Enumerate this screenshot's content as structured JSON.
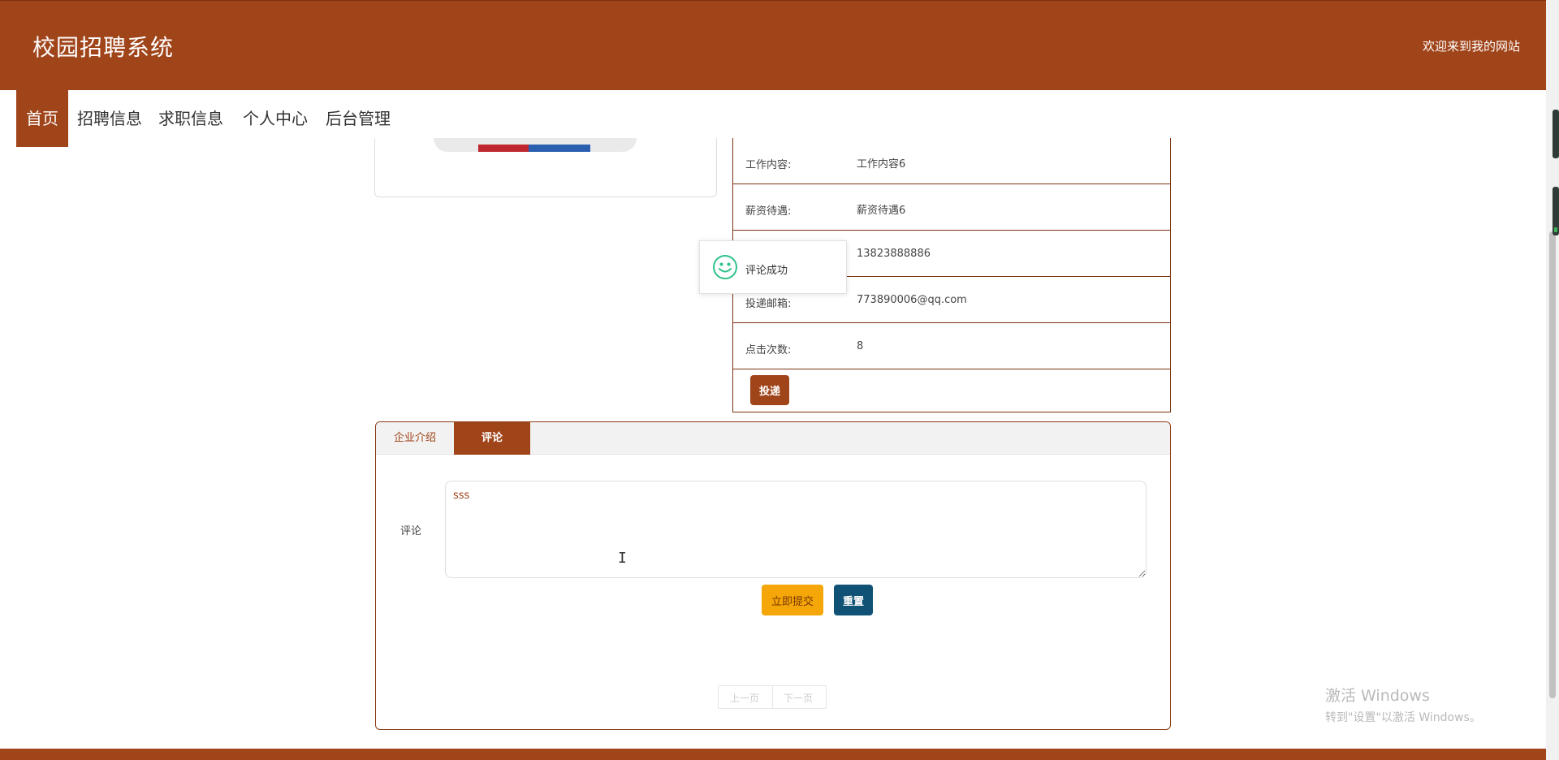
{
  "header": {
    "site_title": "校园招聘系统",
    "welcome": "欢迎来到我的网站"
  },
  "nav": {
    "items": [
      {
        "label": "首页",
        "active": true
      },
      {
        "label": "招聘信息",
        "active": false
      },
      {
        "label": "求职信息",
        "active": false
      },
      {
        "label": "个人中心",
        "active": false
      },
      {
        "label": "后台管理",
        "active": false
      }
    ]
  },
  "details": {
    "rows": [
      {
        "label": "工作内容:",
        "value": "工作内容6"
      },
      {
        "label": "薪资待遇:",
        "value": "薪资待遇6"
      },
      {
        "label": "",
        "value": "13823888886"
      },
      {
        "label": "投递邮箱:",
        "value": "773890006@qq.com"
      },
      {
        "label": "点击次数:",
        "value": "8"
      }
    ],
    "submit_label": "投递"
  },
  "toast": {
    "message": "评论成功",
    "icon": "smile-icon",
    "color": "#2fc28a"
  },
  "tabs": {
    "items": [
      {
        "label": "企业介绍",
        "active": false
      },
      {
        "label": "评论",
        "active": true
      }
    ]
  },
  "comment": {
    "label": "评论",
    "value": "sss",
    "submit_label": "立即提交",
    "reset_label": "重置"
  },
  "pager": {
    "prev": "上一页",
    "next": "下一页"
  },
  "watermark": {
    "line1": "激活 Windows",
    "line2": "转到\"设置\"以激活 Windows。"
  },
  "colors": {
    "brand": "#a0441a",
    "submit": "#f5a608",
    "reset": "#0f5275"
  }
}
